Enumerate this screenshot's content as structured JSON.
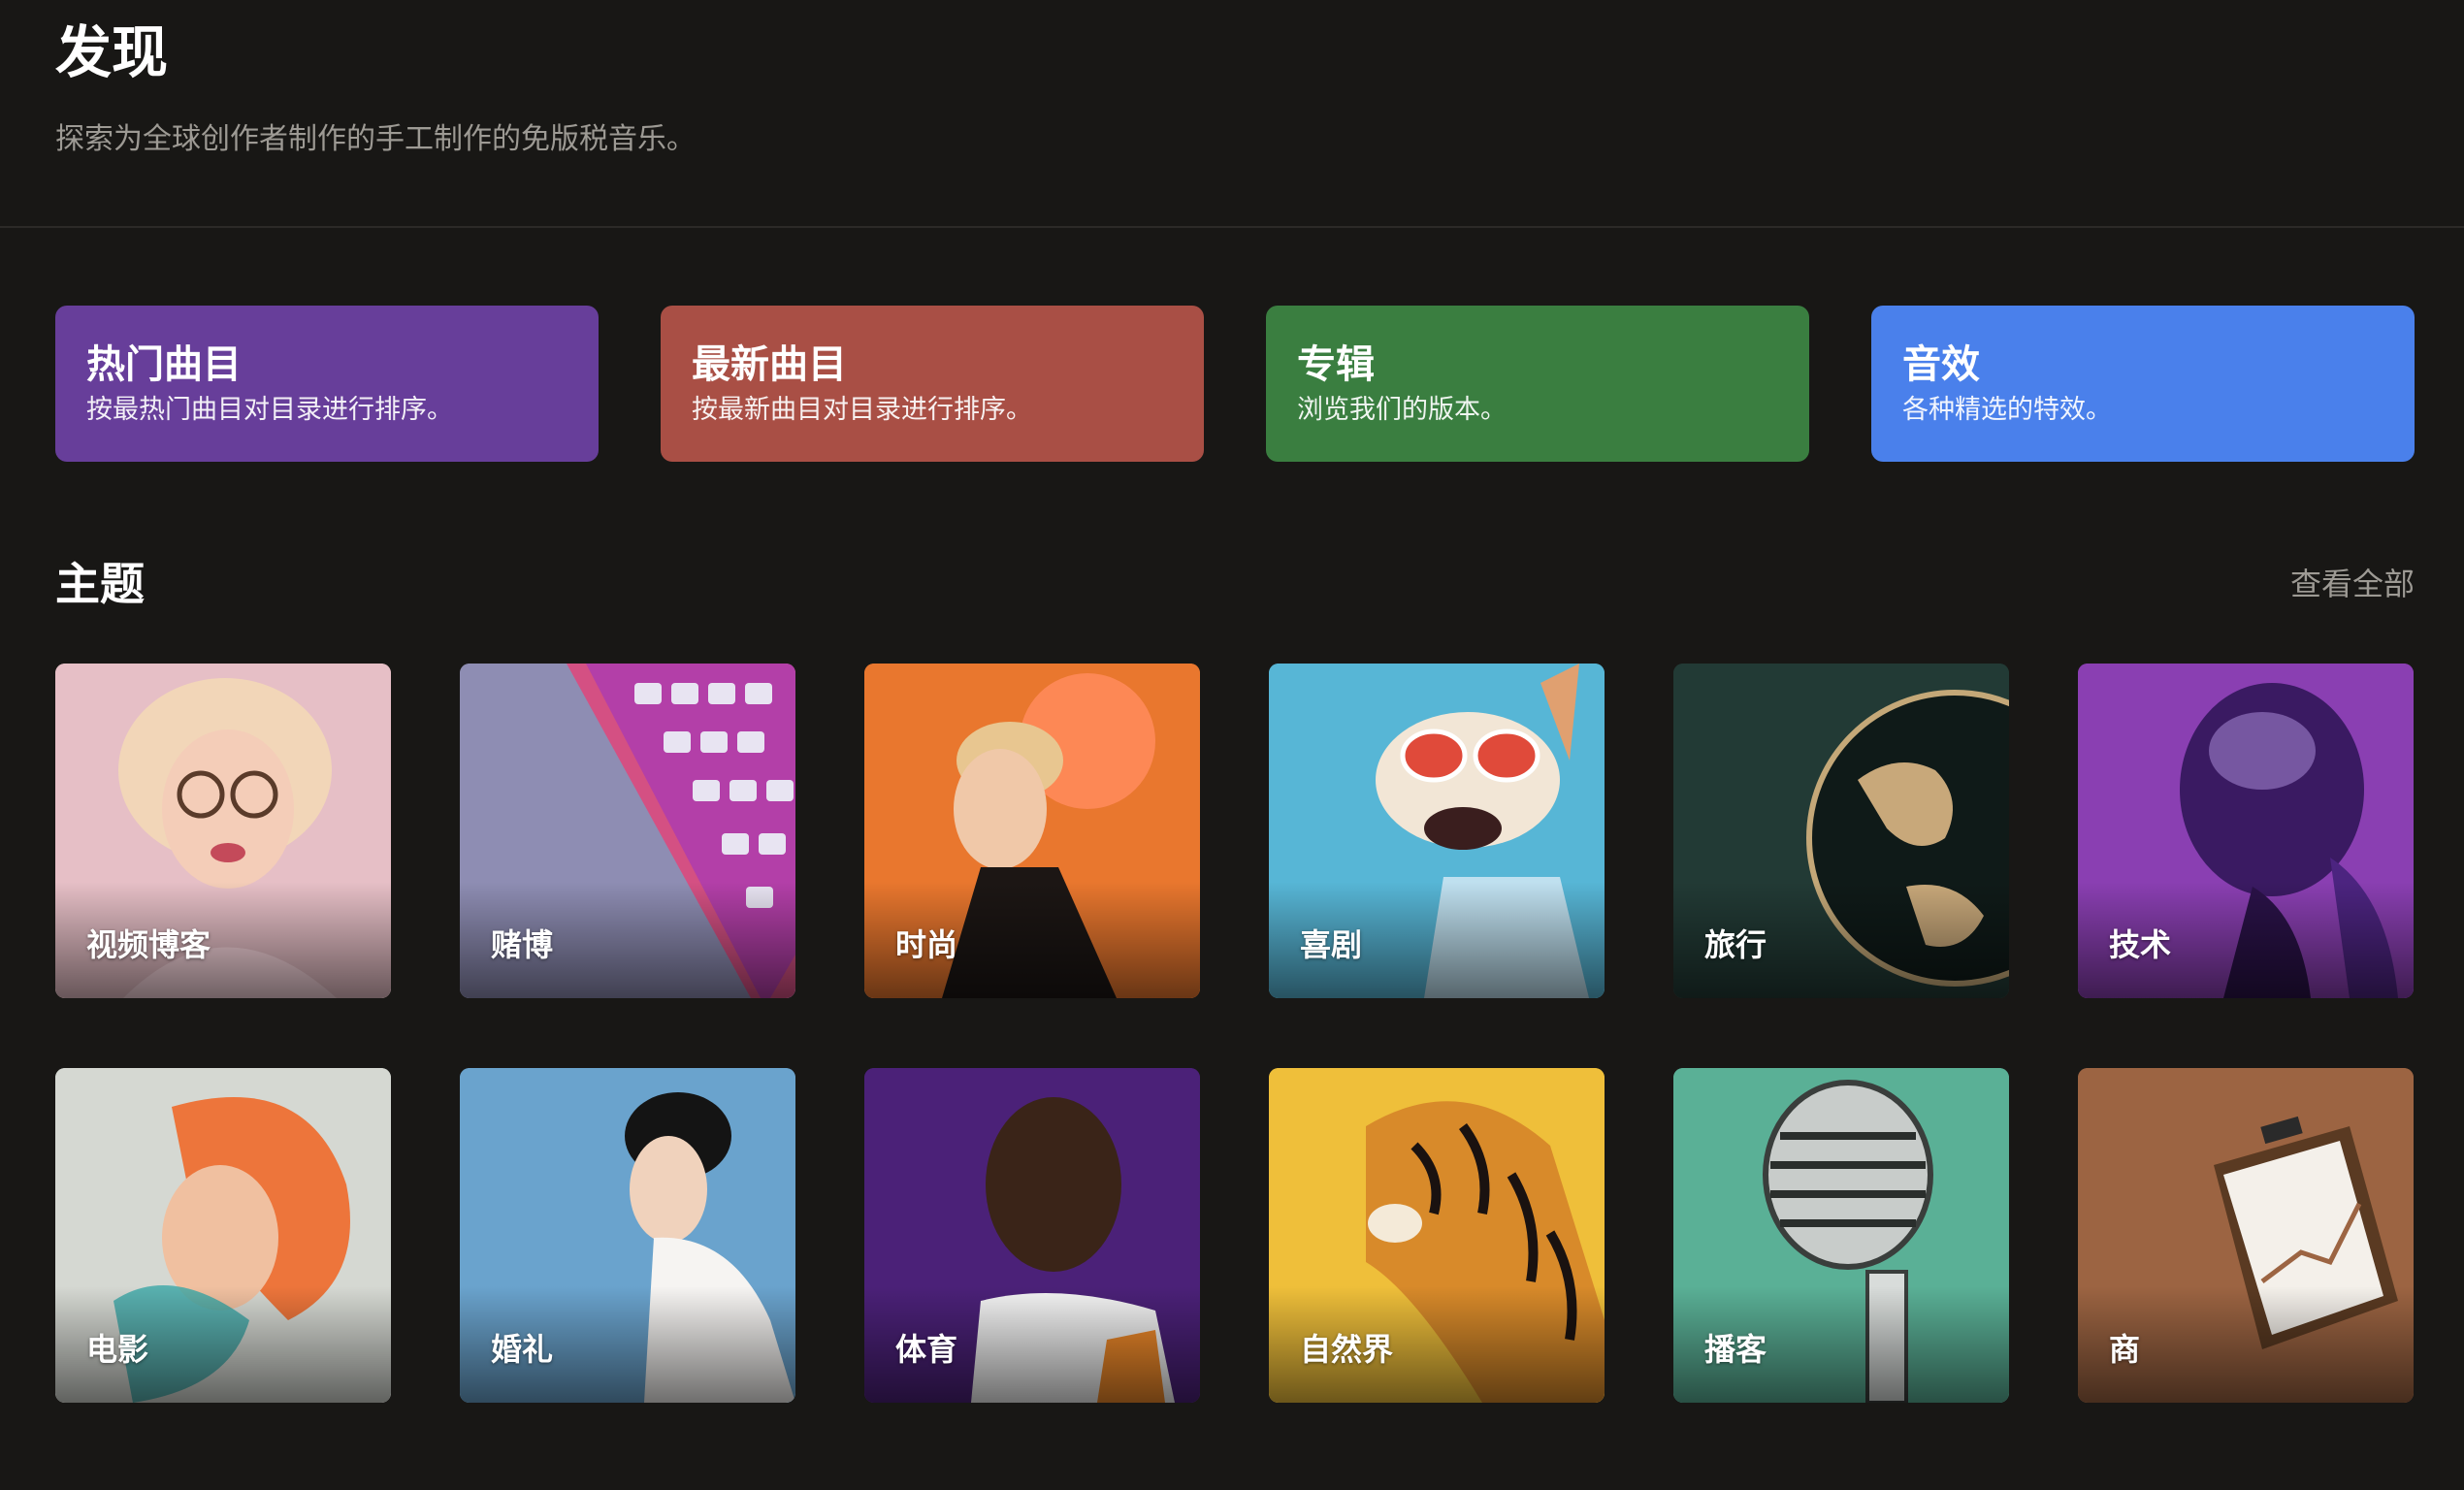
{
  "header": {
    "title": "发现",
    "subtitle": "探索为全球创作者制作的手工制作的免版税音乐。"
  },
  "categories": [
    {
      "title": "热门曲目",
      "description": "按最热门曲目对目录进行排序。",
      "color": "#673e9a"
    },
    {
      "title": "最新曲目",
      "description": "按最新曲目对目录进行排序。",
      "color": "#a94f45"
    },
    {
      "title": "专辑",
      "description": "浏览我们的版本。",
      "color": "#3a7e40"
    },
    {
      "title": "音效",
      "description": "各种精选的特效。",
      "color": "#4a80eb"
    }
  ],
  "themes_section": {
    "title": "主题",
    "view_all": "查看全部"
  },
  "themes": [
    {
      "label": "视频博客",
      "icon": "blonde-woman-glasses-image",
      "bg": "#e6bfc6"
    },
    {
      "label": "赌博",
      "icon": "keyboard-image",
      "bg": "#8e8db3"
    },
    {
      "label": "时尚",
      "icon": "fashion-woman-image",
      "bg": "#e9772e"
    },
    {
      "label": "喜剧",
      "icon": "dog-sunglasses-image",
      "bg": "#57b6d6"
    },
    {
      "label": "旅行",
      "icon": "globe-image",
      "bg": "#223a35"
    },
    {
      "label": "技术",
      "icon": "robot-head-image",
      "bg": "#8a3fb2"
    },
    {
      "label": "电影",
      "icon": "paint-splash-woman-image",
      "bg": "#d5d8d2"
    },
    {
      "label": "婚礼",
      "icon": "bride-image",
      "bg": "#6aa3cd"
    },
    {
      "label": "体育",
      "icon": "athlete-image",
      "bg": "#4b2178"
    },
    {
      "label": "自然界",
      "icon": "tiger-image",
      "bg": "#efbf3a"
    },
    {
      "label": "播客",
      "icon": "microphone-image",
      "bg": "#5ab096"
    },
    {
      "label": "商",
      "icon": "clipboard-chart-image",
      "bg": "#9c6442"
    }
  ]
}
